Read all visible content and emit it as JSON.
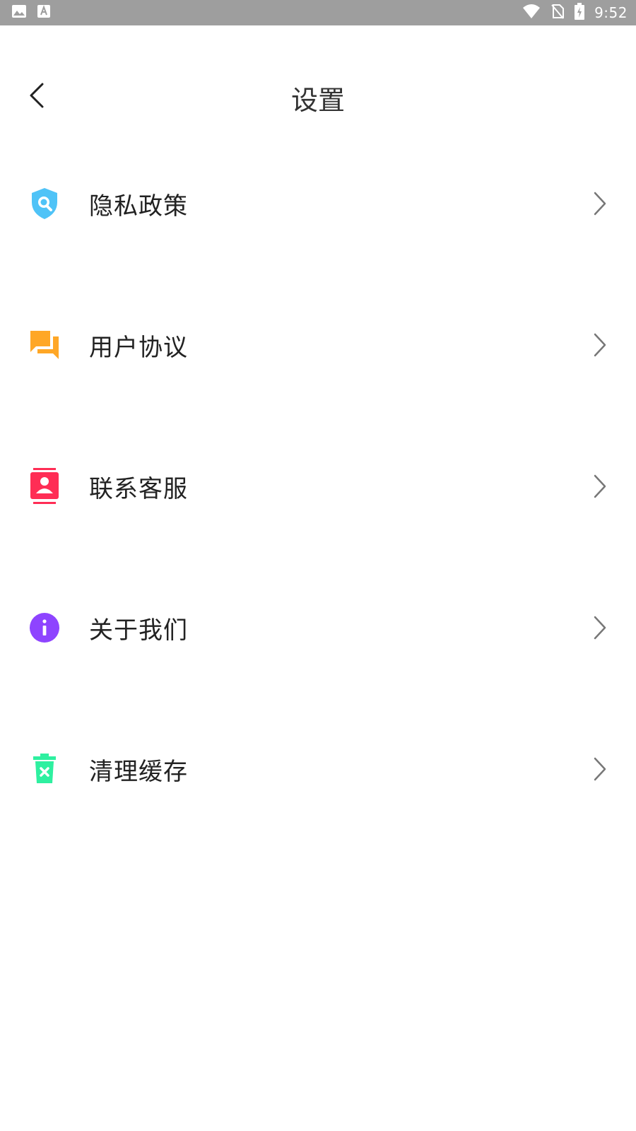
{
  "status_bar": {
    "time": "9:52",
    "icons": [
      "image-icon",
      "font-icon",
      "wifi-icon",
      "no-sim-icon",
      "battery-charging-icon"
    ]
  },
  "header": {
    "title": "设置",
    "back_icon": "back-arrow-icon"
  },
  "settings": {
    "items": [
      {
        "label": "隐私政策",
        "icon": "shield-search-icon",
        "color": "#4fc3f7"
      },
      {
        "label": "用户协议",
        "icon": "chat-bubbles-icon",
        "color": "#ffa726"
      },
      {
        "label": "联系客服",
        "icon": "contact-card-icon",
        "color": "#ff2d55"
      },
      {
        "label": "关于我们",
        "icon": "info-icon",
        "color": "#8e44ff"
      },
      {
        "label": "清理缓存",
        "icon": "trash-icon",
        "color": "#2ef0a0"
      }
    ]
  }
}
